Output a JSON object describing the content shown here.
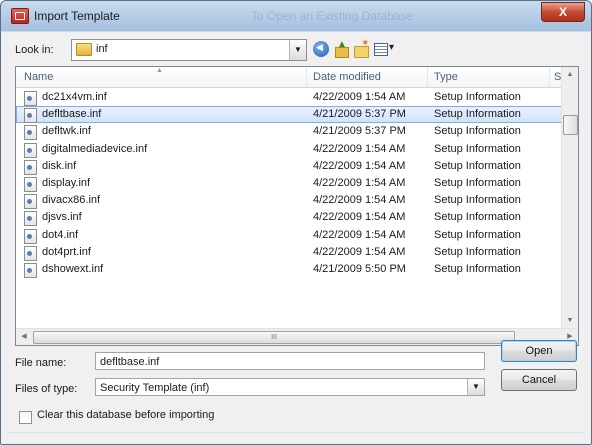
{
  "window": {
    "title": "Import Template",
    "background_title": "To Open an Existing Database",
    "close_glyph": "X"
  },
  "toolbar": {
    "look_in_label": "Look in:",
    "look_in_value": "inf"
  },
  "columns": {
    "name": "Name",
    "date": "Date modified",
    "type": "Type",
    "size": "Si"
  },
  "files": [
    {
      "name": "dc21x4vm.inf",
      "date": "4/22/2009 1:54 AM",
      "type": "Setup Information"
    },
    {
      "name": "defltbase.inf",
      "date": "4/21/2009 5:37 PM",
      "type": "Setup Information",
      "selected": true
    },
    {
      "name": "defltwk.inf",
      "date": "4/21/2009 5:37 PM",
      "type": "Setup Information"
    },
    {
      "name": "digitalmediadevice.inf",
      "date": "4/22/2009 1:54 AM",
      "type": "Setup Information"
    },
    {
      "name": "disk.inf",
      "date": "4/22/2009 1:54 AM",
      "type": "Setup Information"
    },
    {
      "name": "display.inf",
      "date": "4/22/2009 1:54 AM",
      "type": "Setup Information"
    },
    {
      "name": "divacx86.inf",
      "date": "4/22/2009 1:54 AM",
      "type": "Setup Information"
    },
    {
      "name": "djsvs.inf",
      "date": "4/22/2009 1:54 AM",
      "type": "Setup Information"
    },
    {
      "name": "dot4.inf",
      "date": "4/22/2009 1:54 AM",
      "type": "Setup Information"
    },
    {
      "name": "dot4prt.inf",
      "date": "4/22/2009 1:54 AM",
      "type": "Setup Information"
    },
    {
      "name": "dshowext.inf",
      "date": "4/21/2009 5:50 PM",
      "type": "Setup Information"
    }
  ],
  "form": {
    "file_name_label": "File name:",
    "file_name_value": "defltbase.inf",
    "file_type_label": "Files of type:",
    "file_type_value": "Security Template (inf)",
    "open_label": "Open",
    "cancel_label": "Cancel",
    "clear_checkbox_label": "Clear this database before importing",
    "clear_checked": false
  },
  "scroll": {
    "hthumb_grip": "III"
  }
}
